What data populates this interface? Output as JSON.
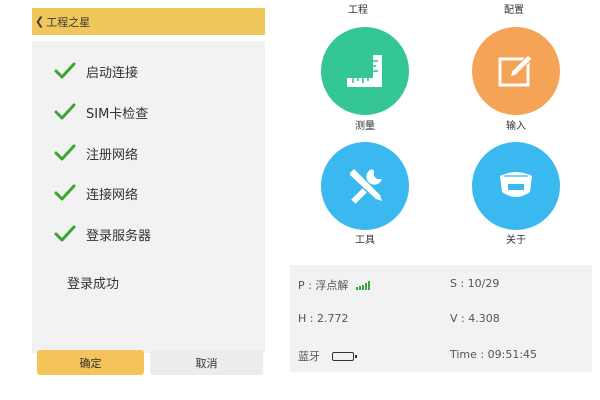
{
  "dialog": {
    "back_icon": "chevron-left-icon",
    "title": "工程之星",
    "steps": [
      {
        "label": "启动连接",
        "status": "done"
      },
      {
        "label": "SIM卡检查",
        "status": "done"
      },
      {
        "label": "注册网络",
        "status": "done"
      },
      {
        "label": "连接网络",
        "status": "done"
      },
      {
        "label": "登录服务器",
        "status": "done"
      }
    ],
    "result": "登录成功",
    "ok_label": "确定",
    "cancel_label": "取消",
    "check_color": "#3aa52f",
    "accent_color": "#f0c75a"
  },
  "menu": {
    "top_labels": [
      "工程",
      "配置"
    ],
    "items": [
      {
        "label": "测量",
        "icon": "ruler-icon",
        "color": "#35c695"
      },
      {
        "label": "输入",
        "icon": "edit-icon",
        "color": "#f5a356"
      },
      {
        "label": "工具",
        "icon": "tools-icon",
        "color": "#3ab8f0"
      },
      {
        "label": "关于",
        "icon": "receiver-icon",
        "color": "#3ab8f0"
      }
    ]
  },
  "status": {
    "position": "P : 浮点解",
    "satellites": "S : 10/29",
    "h_precision": "H : 2.772",
    "v_precision": "V : 4.308",
    "bluetooth": "蓝牙",
    "time": "Time :  09:51:45",
    "signal_color": "#2fae3e"
  }
}
